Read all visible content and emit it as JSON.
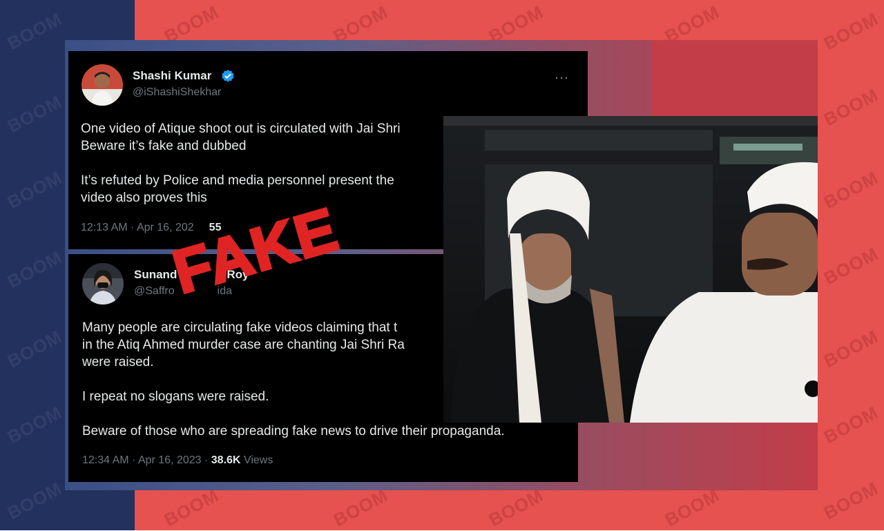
{
  "watermark": "BOOM",
  "colors": {
    "bg_left": "#22315e",
    "bg_right": "#e5524f",
    "stamp": "#e02424",
    "verified": "#1d9bf0"
  },
  "tweet1": {
    "name": "Shashi Kumar",
    "handle": "@iShashiShekhar",
    "verified": true,
    "more_icon": "…",
    "line1": "One video of Atique shoot out is circulated with Jai Shri",
    "line2": "Beware it’s fake and dubbed",
    "line3": "It’s refuted by Police and media personnel present the",
    "line4": "video also proves this",
    "time": "12:13 AM · Apr 16, 202",
    "views_partial": "55"
  },
  "tweet2": {
    "name": "Sunand",
    "name_tail": "Roy",
    "handle": "@Saffro",
    "handle_tail": "ida",
    "line1": "Many people are circulating fake videos claiming that t",
    "line2": "in the Atiq Ahmed murder case are chanting Jai Shri Ra",
    "line3": "were raised.",
    "line4": "I repeat no slogans were raised.",
    "line5": "Beware of those who are spreading fake news to drive their propaganda.",
    "time": "12:34 AM · Apr 16, 2023 · ",
    "views": "38.6K",
    "views_label": " Views"
  },
  "stamp": {
    "text": "FAKE"
  }
}
